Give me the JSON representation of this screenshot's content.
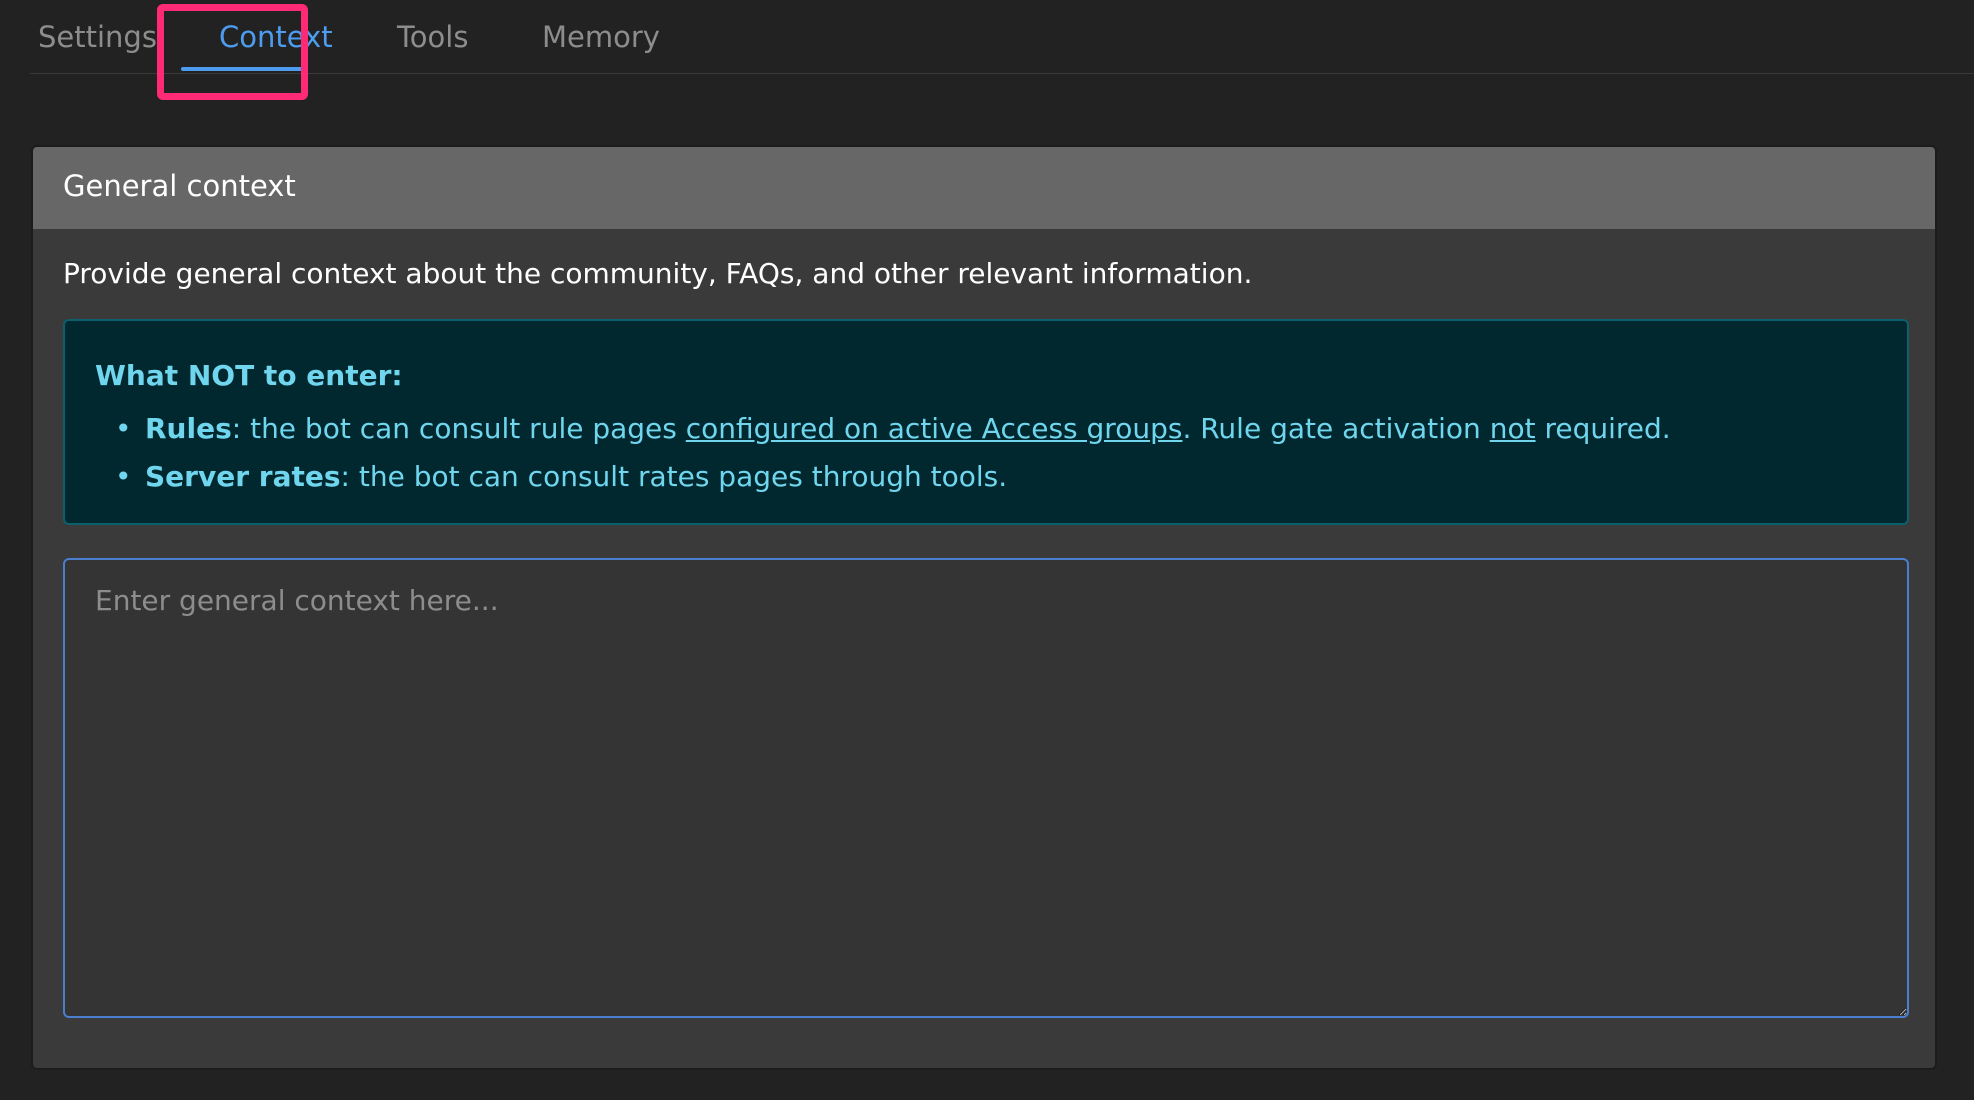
{
  "tabs": [
    {
      "label": "Settings"
    },
    {
      "label": "Context"
    },
    {
      "label": "Tools"
    },
    {
      "label": "Memory"
    }
  ],
  "active_tab": "Context",
  "colors": {
    "active_tab": "#4d9cf0",
    "highlight": "#ff2a75",
    "info_text": "#6fd6ee",
    "info_bg": "#01272f"
  },
  "card": {
    "title": "General context",
    "description": "Provide general context about the community, FAQs, and other relevant information."
  },
  "notice": {
    "heading": "What NOT to enter:",
    "items": [
      {
        "term": "Rules",
        "text_before": ": the bot can consult rule pages ",
        "link": "configured on active Access groups",
        "text_middle": ". Rule gate activation ",
        "emphasis": "not",
        "text_after": " required."
      },
      {
        "term": "Server rates",
        "text": ": the bot can consult rates pages through tools."
      }
    ]
  },
  "context_input": {
    "value": "",
    "placeholder": "Enter general context here..."
  }
}
